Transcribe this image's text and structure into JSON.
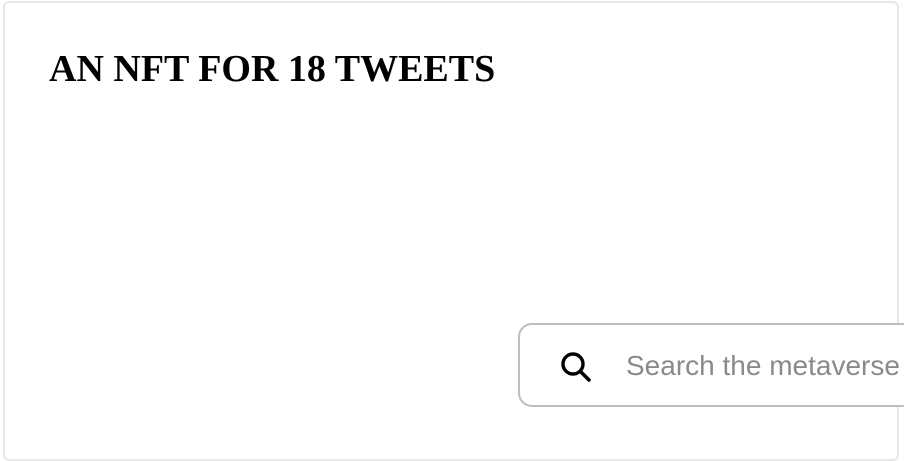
{
  "article": {
    "title": "AN NFT FOR 18 TWEETS"
  },
  "search": {
    "icon": "search-icon",
    "placeholder": "Search the metaverse",
    "value": ""
  }
}
